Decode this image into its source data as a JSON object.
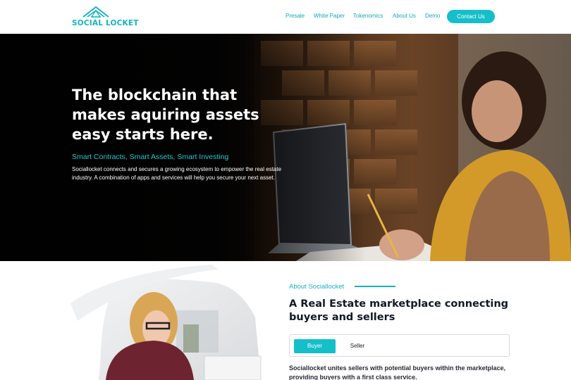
{
  "header": {
    "logo_text": "SOCIAL LOCKET",
    "nav": [
      {
        "label": "Presale"
      },
      {
        "label": "White Paper"
      },
      {
        "label": "Tokenomics"
      },
      {
        "label": "About Us"
      },
      {
        "label": "Demo"
      }
    ],
    "contact_label": "Contact Us"
  },
  "hero": {
    "title": "The blockchain that makes aquiring assets easy starts here.",
    "subtitle": "Smart Contracts, Smart Assets, Smart Investing",
    "description": "Sociallocket connects and secures a growing ecosystem to empower the real estate industry. A combination of apps and services will help you secure your next asset."
  },
  "about": {
    "label": "About Sociallocket",
    "title": "A Real Estate marketplace connecting buyers and sellers",
    "tabs": [
      {
        "label": "Buyer",
        "active": true
      },
      {
        "label": "Seller",
        "active": false
      }
    ],
    "text": "Sociallocket unites sellers with potential buyers within the marketplace, providing buyers with a first class service."
  },
  "colors": {
    "accent": "#14bfc9",
    "dark": "#111827"
  }
}
